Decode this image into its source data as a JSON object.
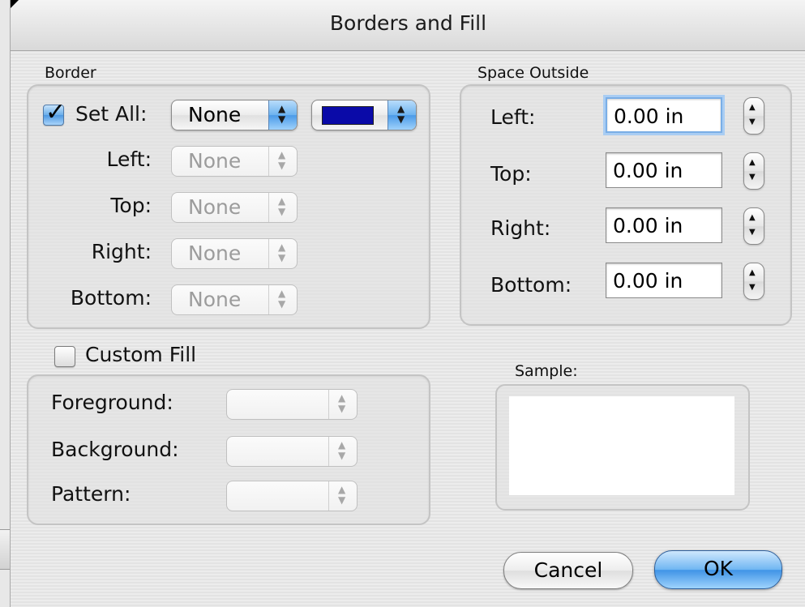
{
  "window": {
    "title": "Borders and Fill"
  },
  "border": {
    "group_label": "Border",
    "set_all": {
      "label": "Set All:",
      "checked": true,
      "style_value": "None",
      "color": "#0a0aa8"
    },
    "sides": [
      {
        "label": "Left:",
        "value": "None"
      },
      {
        "label": "Top:",
        "value": "None"
      },
      {
        "label": "Right:",
        "value": "None"
      },
      {
        "label": "Bottom:",
        "value": "None"
      }
    ]
  },
  "space_outside": {
    "group_label": "Space Outside",
    "fields": [
      {
        "label": "Left:",
        "value": "0.00 in"
      },
      {
        "label": "Top:",
        "value": "0.00 in"
      },
      {
        "label": "Right:",
        "value": "0.00 in"
      },
      {
        "label": "Bottom:",
        "value": "0.00 in"
      }
    ]
  },
  "custom_fill": {
    "label": "Custom Fill",
    "checked": false,
    "rows": [
      {
        "label": "Foreground:",
        "value": ""
      },
      {
        "label": "Background:",
        "value": ""
      },
      {
        "label": "Pattern:",
        "value": ""
      }
    ]
  },
  "sample": {
    "label": "Sample:"
  },
  "buttons": {
    "cancel": "Cancel",
    "ok": "OK"
  },
  "colors": {
    "accent_blue": "#4a9ae8",
    "swatch": "#0a0aa8"
  }
}
